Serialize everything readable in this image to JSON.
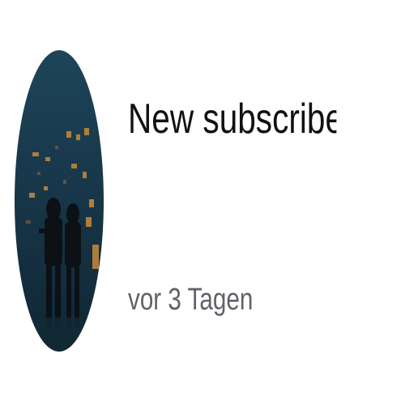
{
  "notification": {
    "title": "New subscriber: Greg",
    "timestamp": "vor 3 Tagen",
    "avatar": {
      "icon": "avatar-photo",
      "colors": {
        "background": "#18374a",
        "city_lights": "#c98a3a",
        "silhouette": "#0c1115"
      }
    }
  }
}
